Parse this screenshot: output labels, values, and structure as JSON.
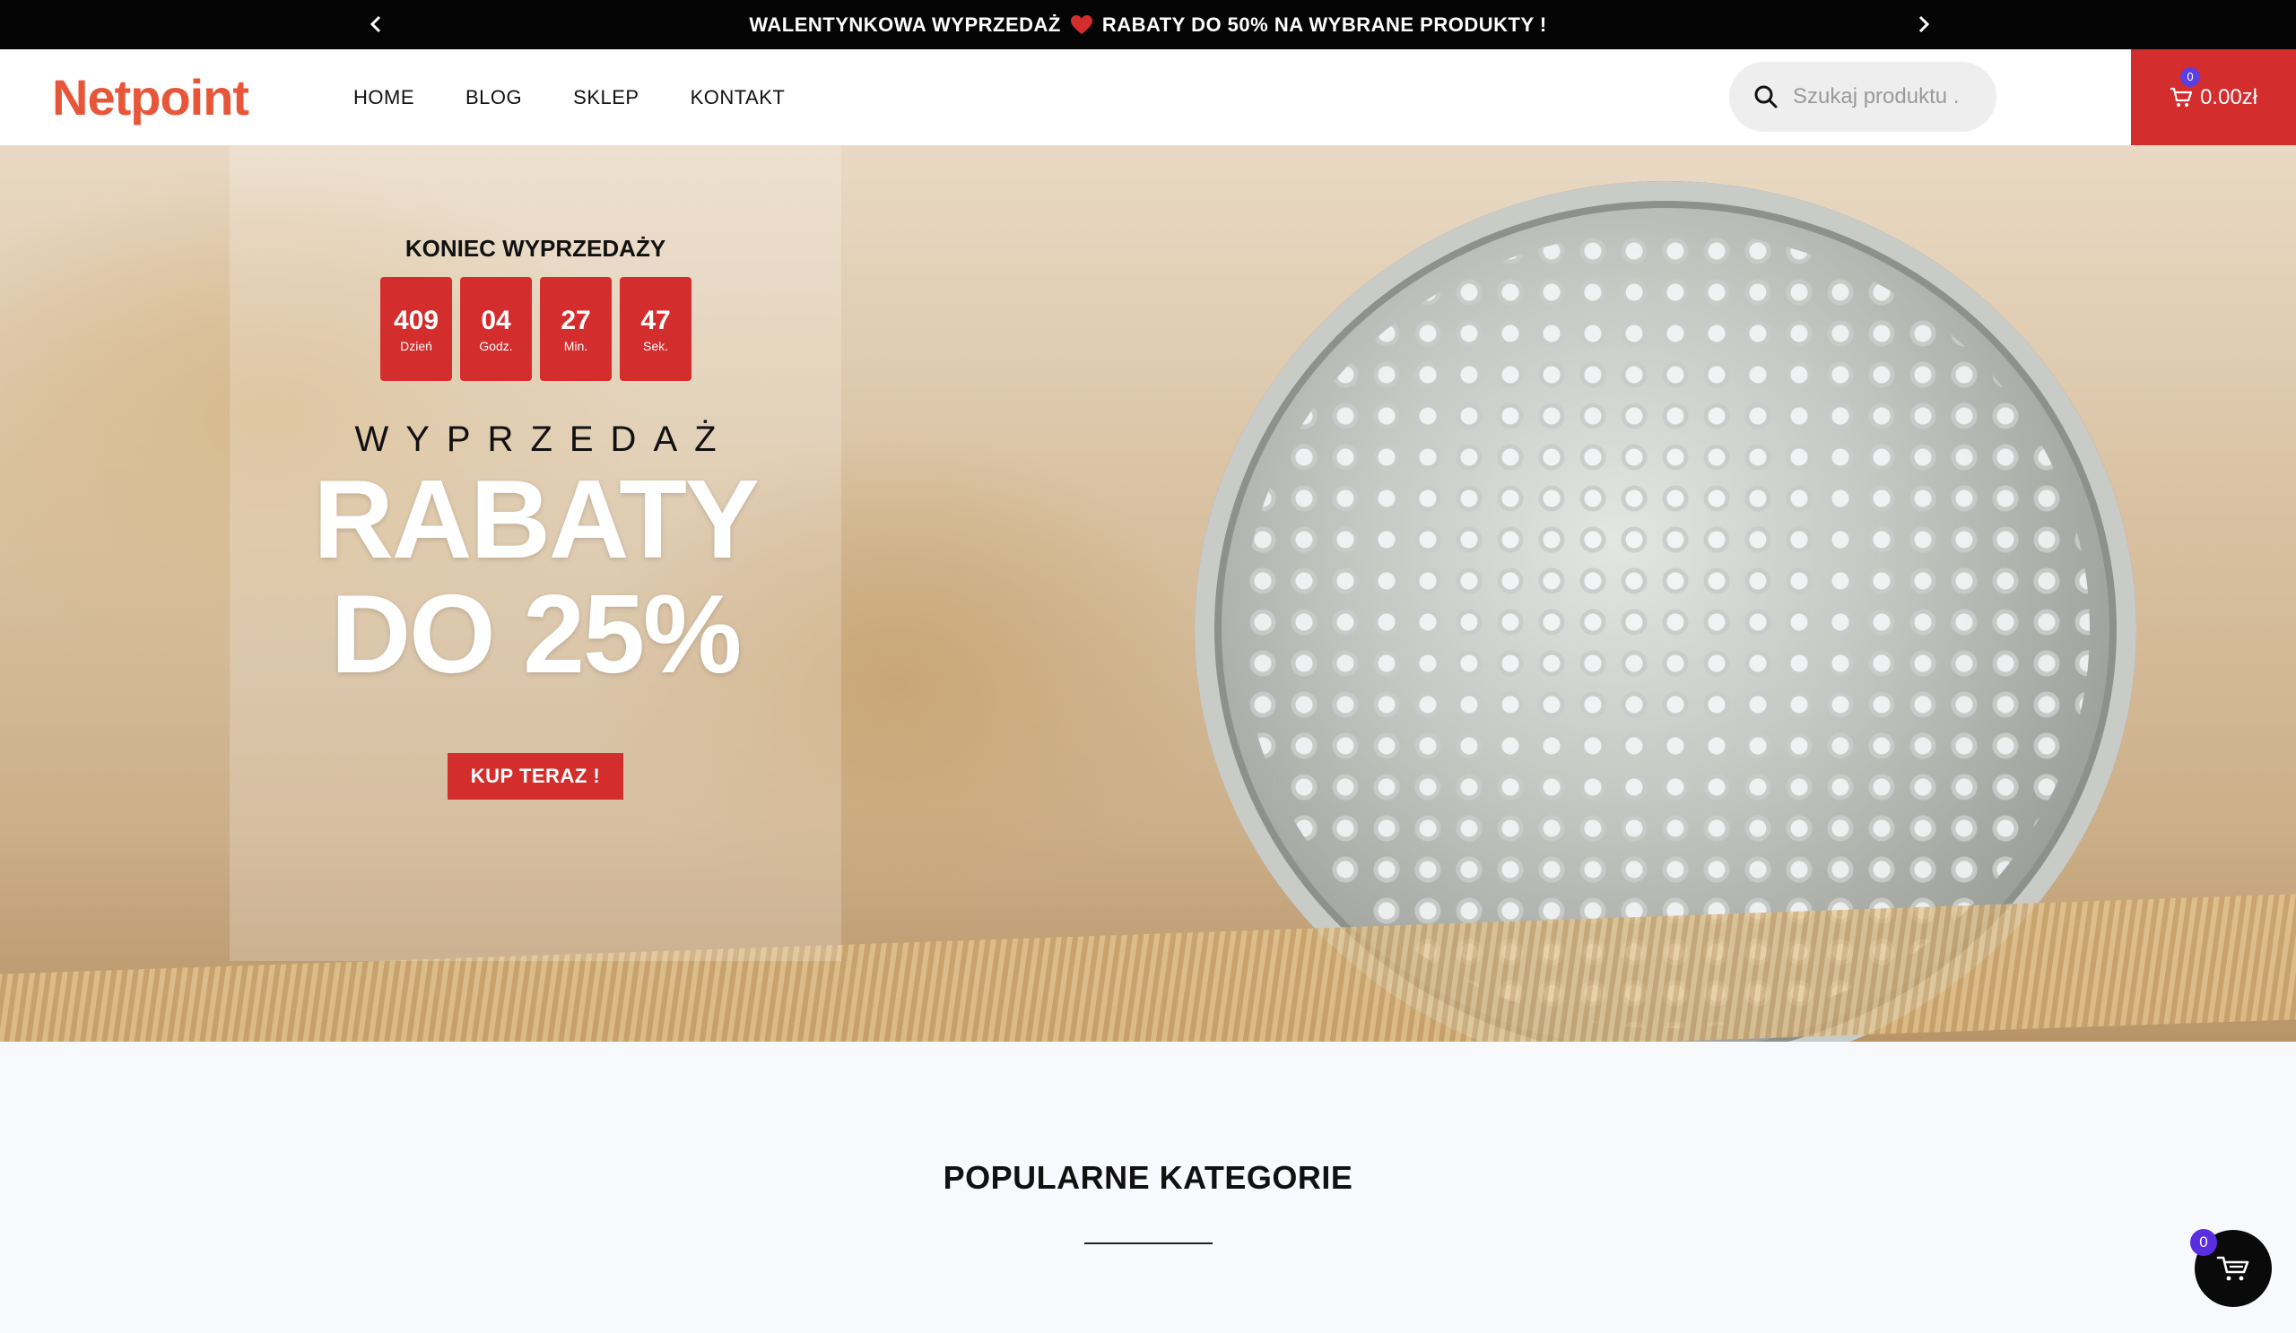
{
  "announcement": {
    "text_before": "WALENTYNKOWA WYPRZEDAŻ",
    "text_after": "RABATY DO 50% NA WYBRANE PRODUKTY !",
    "heart_color": "#d42d2d"
  },
  "header": {
    "logo_text": "Netpoint",
    "nav": [
      "HOME",
      "BLOG",
      "SKLEP",
      "KONTAKT"
    ],
    "search_placeholder": "Szukaj produktu .",
    "cart_count": "0",
    "cart_total": "0.00zł"
  },
  "hero": {
    "countdown_title": "KONIEC WYPRZEDAŻY",
    "countdown": [
      {
        "value": "409",
        "label": "Dzień"
      },
      {
        "value": "04",
        "label": "Godz."
      },
      {
        "value": "27",
        "label": "Min."
      },
      {
        "value": "47",
        "label": "Sek."
      }
    ],
    "sale_label": "WYPRZEDAŻ",
    "headline_line1": "RABATY",
    "headline_line2": "DO 25%",
    "cta": "KUP TERAZ !"
  },
  "section": {
    "title": "POPULARNE KATEGORIE"
  },
  "floating_cart": {
    "count": "0"
  },
  "colors": {
    "accent": "#d42d2d",
    "badge": "#5b3fe0"
  }
}
